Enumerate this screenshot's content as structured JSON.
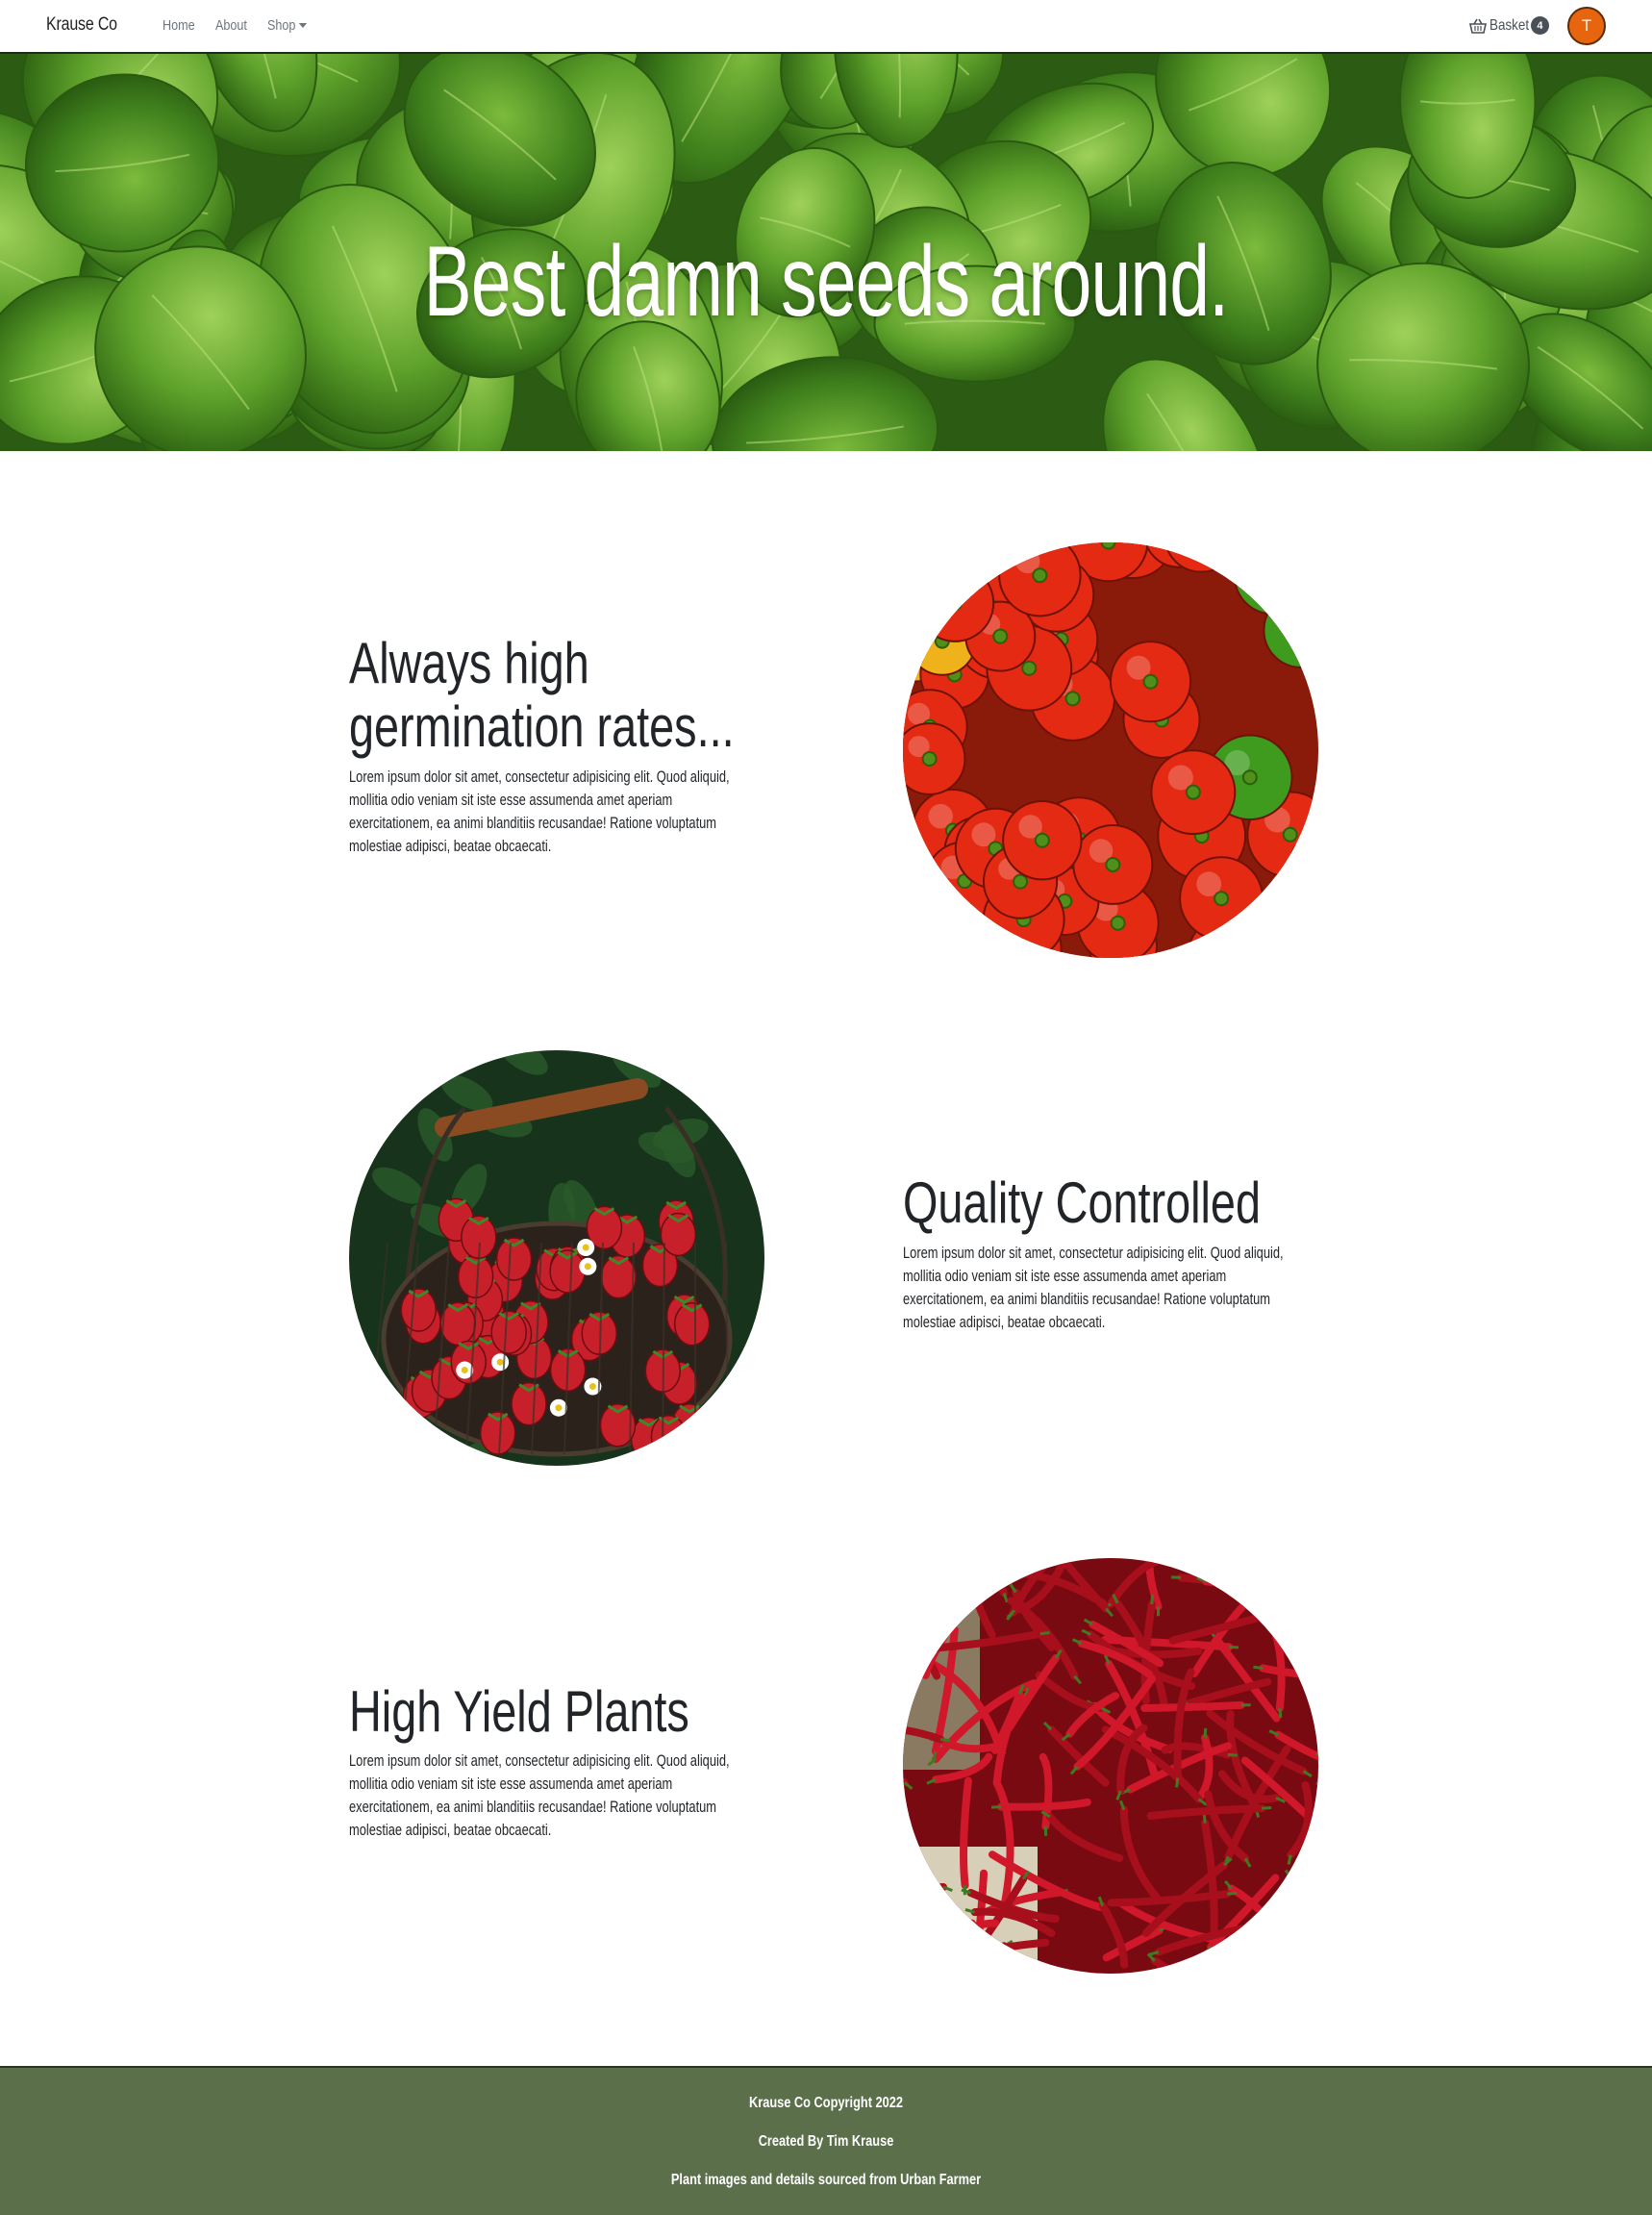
{
  "navbar": {
    "brand": "Krause Co",
    "links": [
      "Home",
      "About",
      "Shop"
    ],
    "basket_label": "Basket",
    "basket_count": "4",
    "avatar_initial": "T",
    "colors": {
      "avatar": "#e8650f"
    }
  },
  "hero": {
    "title": "Best damn seeds around."
  },
  "features": [
    {
      "heading": "Always high germination rates...",
      "heading_line1": "Always high",
      "heading_line2": "germination rates...",
      "text": "Lorem ipsum dolor sit amet, consectetur adipisicing elit. Quod aliquid, mollitia odio veniam sit iste esse assumenda amet aperiam exercitationem, ea animi blanditiis recusandae! Ratione voluptatum molestiae adipisci, beatae obcaecati.",
      "image": "red and green bell peppers"
    },
    {
      "heading": "Quality Controlled",
      "text": "Lorem ipsum dolor sit amet, consectetur adipisicing elit. Quod aliquid, mollitia odio veniam sit iste esse assumenda amet aperiam exercitationem, ea animi blanditiis recusandae! Ratione voluptatum molestiae adipisci, beatae obcaecati.",
      "image": "basket of strawberries"
    },
    {
      "heading": "High Yield Plants",
      "text": "Lorem ipsum dolor sit amet, consectetur adipisicing elit. Quod aliquid, mollitia odio veniam sit iste esse assumenda amet aperiam exercitationem, ea animi blanditiis recusandae! Ratione voluptatum molestiae adipisci, beatae obcaecati.",
      "image": "red chili peppers"
    }
  ],
  "footer": {
    "copyright": "Krause Co Copyright 2022",
    "created_by": "Created By Tim Krause",
    "sources": "Plant images and details sourced from Urban Farmer",
    "colors": {
      "background": "#5b6f4a"
    }
  }
}
